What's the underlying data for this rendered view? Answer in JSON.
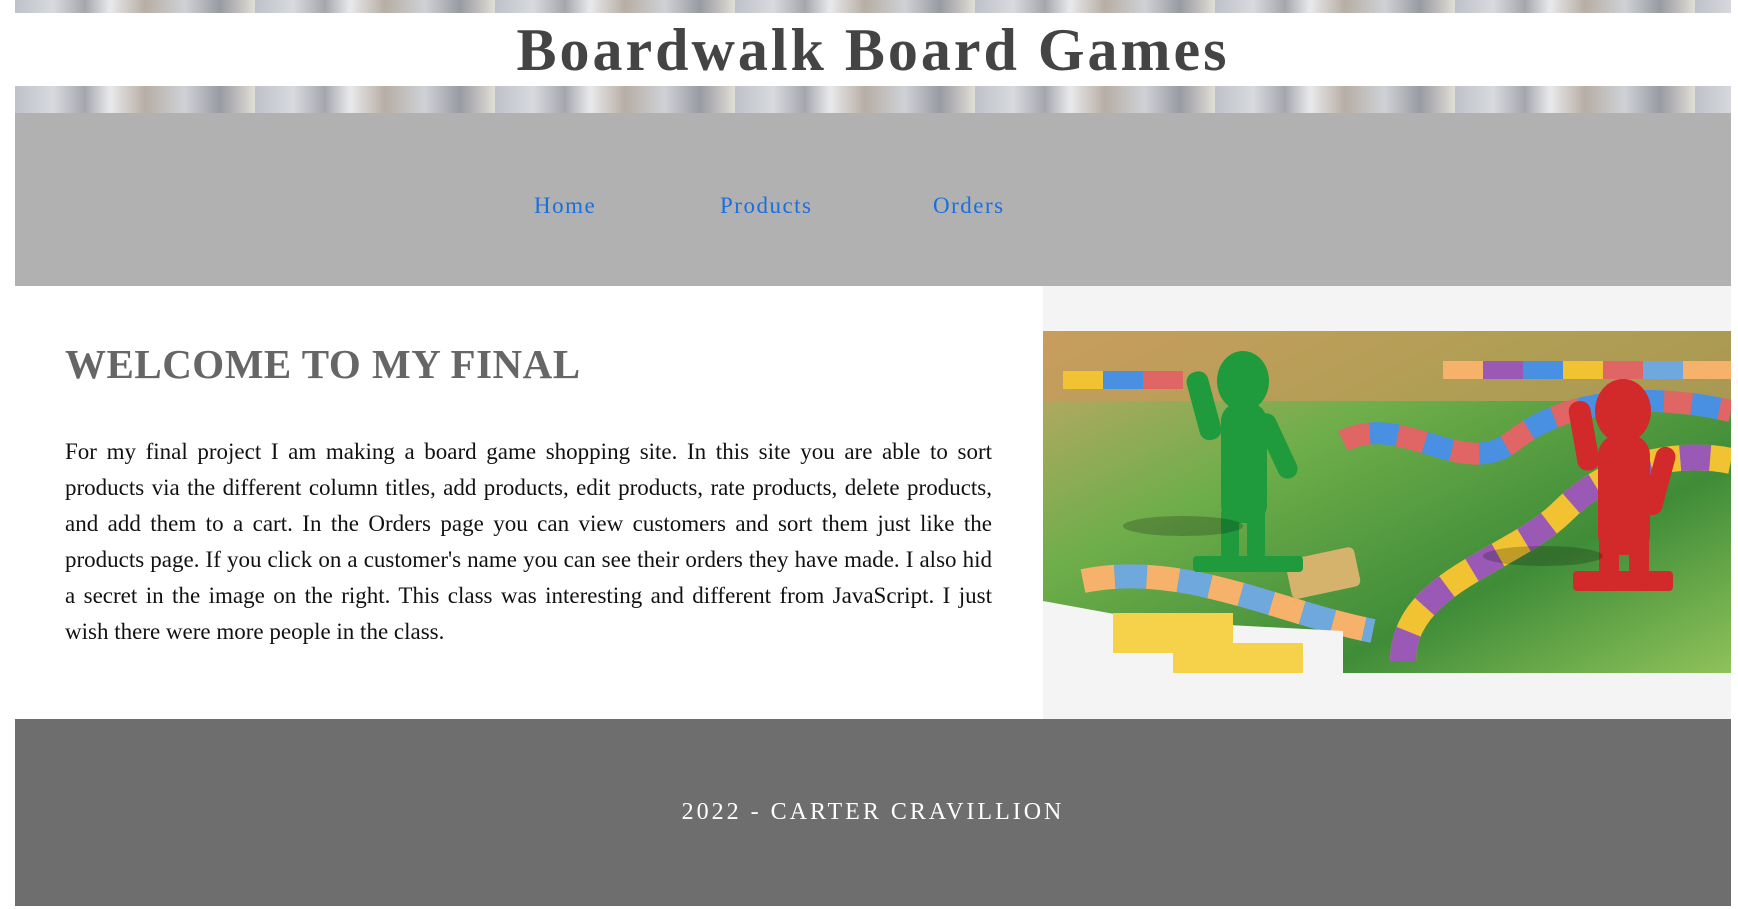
{
  "header": {
    "title": "Boardwalk Board Games"
  },
  "nav": {
    "items": [
      {
        "label": "Home"
      },
      {
        "label": "Products"
      },
      {
        "label": "Orders"
      }
    ],
    "link_color": "#1a6fe0",
    "background": "#b1b1b1"
  },
  "main": {
    "heading": "WELCOME TO MY FINAL",
    "paragraph": "For my final project I am making a board game shopping site. In this site you are able to sort products via the different column titles, add products, edit products, rate products, delete products, and add them to a cart. In the Orders page you can view customers and sort them just like the products page. If you click on a customer's name you can see their orders they have made. I also hid a secret in the image on the right. This class was interesting and different from JavaScript. I just wish there were more people in the class."
  },
  "aside": {
    "image": {
      "icon": "board-game-photo"
    }
  },
  "footer": {
    "text": "2022 - CARTER CRAVILLION",
    "background": "#6e6e6e"
  }
}
